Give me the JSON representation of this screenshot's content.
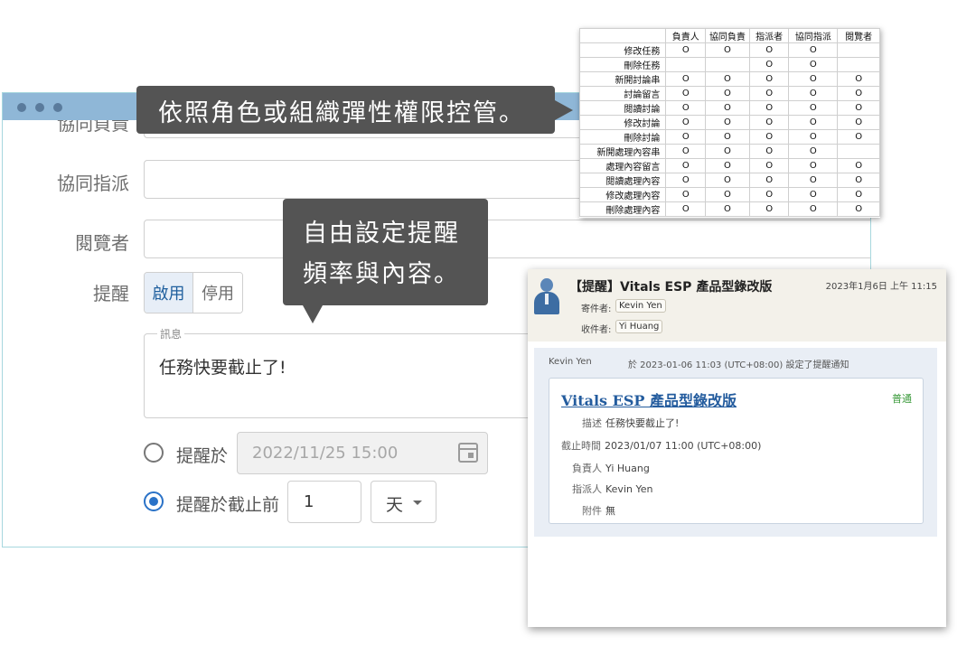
{
  "callouts": {
    "roles": "依照角色或組織彈性權限控管。",
    "reminder_line1": "自由設定提醒",
    "reminder_line2": "頻率與內容。"
  },
  "form": {
    "label_co_owner_partial": "協同負責",
    "label_co_assign": "協同指派",
    "label_viewer": "閱覽者",
    "label_reminder": "提醒",
    "toggle_enable": "啟用",
    "toggle_disable": "停用",
    "message_legend": "訊息",
    "message_text": "任務快要截止了!",
    "radio_remind_at_label": "提醒於",
    "remind_at_placeholder": "2022/11/25 15:00",
    "radio_before_deadline_label": "提醒於截止前",
    "before_deadline_value": "1",
    "unit_value": "天",
    "selected_option": "before_deadline"
  },
  "permissions": {
    "columns": [
      "負責人",
      "協同負責",
      "指派者",
      "協同指派",
      "閱覽者"
    ],
    "rows": [
      {
        "action": "修改任務",
        "cells": [
          "O",
          "O",
          "O",
          "O",
          ""
        ]
      },
      {
        "action": "刪除任務",
        "cells": [
          "",
          "",
          "O",
          "O",
          ""
        ]
      },
      {
        "action": "新開討論串",
        "cells": [
          "O",
          "O",
          "O",
          "O",
          "O"
        ]
      },
      {
        "action": "討論留言",
        "cells": [
          "O",
          "O",
          "O",
          "O",
          "O"
        ]
      },
      {
        "action": "閱讀討論",
        "cells": [
          "O",
          "O",
          "O",
          "O",
          "O"
        ]
      },
      {
        "action": "修改討論",
        "cells": [
          "O",
          "O",
          "O",
          "O",
          "O"
        ]
      },
      {
        "action": "刪除討論",
        "cells": [
          "O",
          "O",
          "O",
          "O",
          "O"
        ]
      },
      {
        "action": "新開處理內容串",
        "cells": [
          "O",
          "O",
          "O",
          "O",
          ""
        ]
      },
      {
        "action": "處理內容留言",
        "cells": [
          "O",
          "O",
          "O",
          "O",
          "O"
        ]
      },
      {
        "action": "閱讀處理內容",
        "cells": [
          "O",
          "O",
          "O",
          "O",
          "O"
        ]
      },
      {
        "action": "修改處理內容",
        "cells": [
          "O",
          "O",
          "O",
          "O",
          "O"
        ]
      },
      {
        "action": "刪除處理內容",
        "cells": [
          "O",
          "O",
          "O",
          "O",
          "O"
        ]
      }
    ]
  },
  "email": {
    "subject": "【提醒】Vitals ESP 產品型錄改版",
    "datetime": "2023年1月6日 上午 11:15",
    "from_label": "寄件者:",
    "from_value": "Kevin Yen",
    "to_label": "收件者:",
    "to_value": "Yi Huang",
    "body_sender": "Kevin Yen",
    "body_note": "於 2023-01-06 11:03 (UTC+08:00) 設定了提醒通知",
    "card_title": "Vitals ESP 產品型錄改版",
    "priority": "普通",
    "desc_key": "描述",
    "desc_value": "任務快要截止了!",
    "deadline_key": "截止時間",
    "deadline_value": "2023/01/07 11:00 (UTC+08:00)",
    "owner_key": "負責人",
    "owner_value": "Yi Huang",
    "assigner_key": "指派人",
    "assigner_value": "Kevin Yen",
    "attach_key": "附件",
    "attach_value": "無"
  },
  "colors": {
    "titlebar": "#8fb7d7",
    "callout_bg": "#545454",
    "link_blue": "#245c9e",
    "radio_blue": "#2a72c7",
    "priority_green": "#3a9a3a"
  }
}
